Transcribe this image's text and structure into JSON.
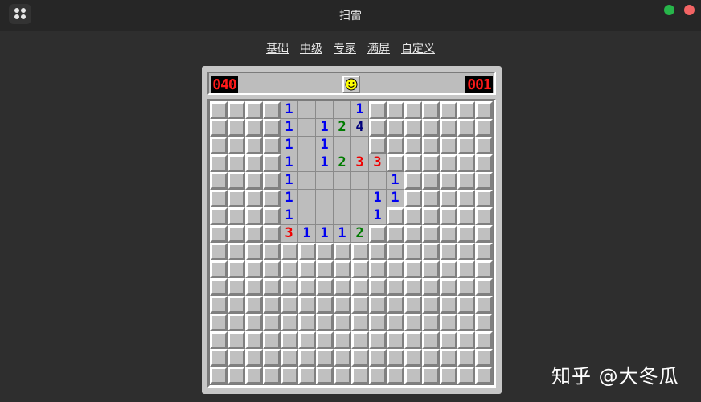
{
  "window": {
    "title": "扫雷"
  },
  "menu": [
    "基础",
    "中级",
    "专家",
    "满屏",
    "自定义"
  ],
  "counters": {
    "mines_left": "040",
    "timer": "001"
  },
  "face": "smiley-icon",
  "colors": {
    "n1": "#0000f0",
    "n2": "#007b00",
    "n3": "#f00000",
    "n4": "#00007b"
  },
  "board": {
    "rows": 16,
    "cols": 16,
    "cells": [
      "????1...1???????",
      "????1.124???????",
      "????1.1..???????",
      "????1.1233??????",
      "????1.....1?????",
      "????1....11?????",
      "????1....1??????",
      "????31112???????",
      "????????????????",
      "????????????????",
      "????????????????",
      "????????????????",
      "????????????????",
      "????????????????",
      "????????????????",
      "????????????????"
    ]
  },
  "watermark": "知乎 @大冬瓜"
}
